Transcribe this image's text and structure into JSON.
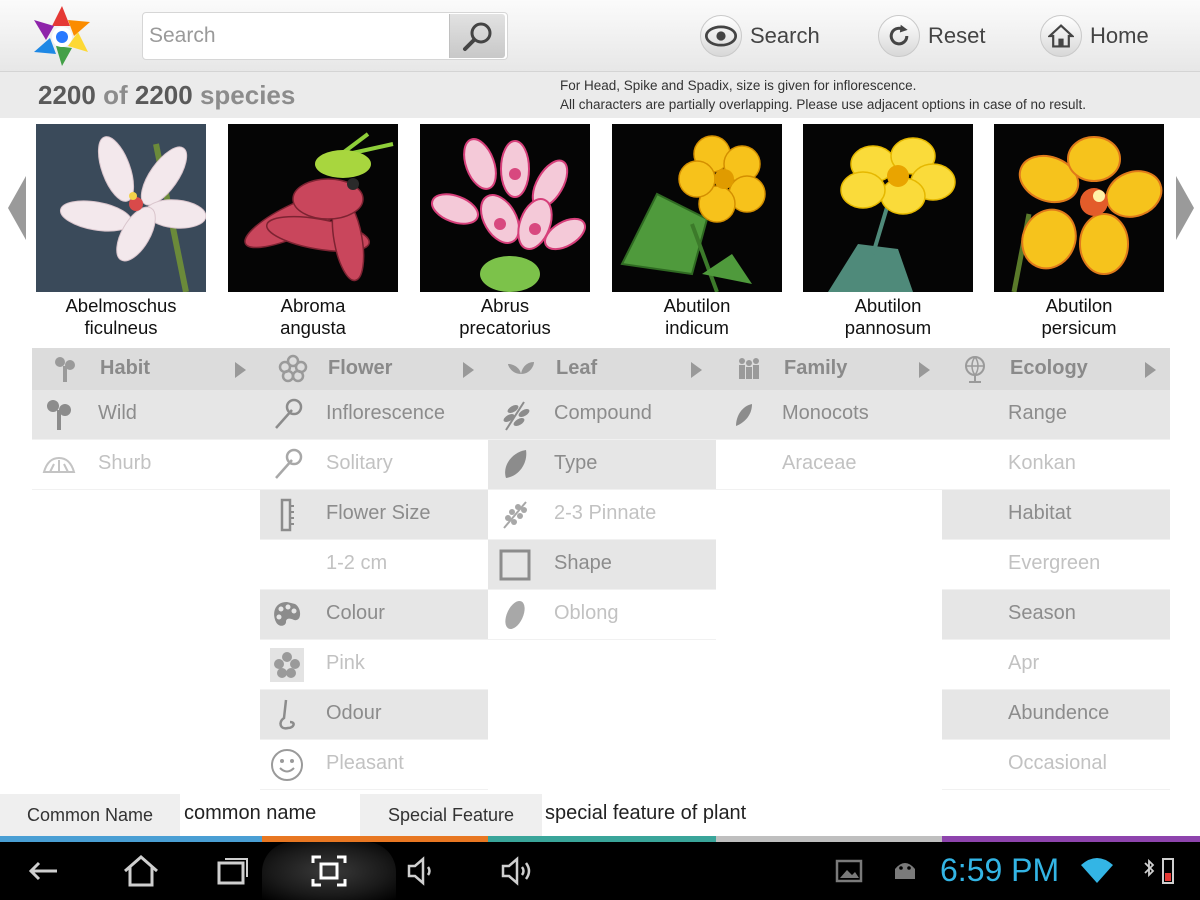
{
  "search": {
    "placeholder": "Search"
  },
  "top_buttons": [
    {
      "label": "Search",
      "icon": "eye-icon"
    },
    {
      "label": "Reset",
      "icon": "reset-icon"
    },
    {
      "label": "Home",
      "icon": "home-icon"
    }
  ],
  "count": {
    "shown": "2200",
    "of": "of",
    "total": "2200",
    "unit": "species"
  },
  "note": {
    "line1": "For Head, Spike and Spadix, size is given for inflorescence.",
    "line2": "All characters are partially overlapping. Please use adjacent options in case of no result."
  },
  "species": [
    {
      "line1": "Abelmoschus",
      "line2": "ficulneus"
    },
    {
      "line1": "Abroma",
      "line2": "angusta"
    },
    {
      "line1": "Abrus",
      "line2": "precatorius"
    },
    {
      "line1": "Abutilon",
      "line2": "indicum"
    },
    {
      "line1": "Abutilon",
      "line2": "pannosum"
    },
    {
      "line1": "Abutilon",
      "line2": "persicum"
    }
  ],
  "filters": {
    "habit": {
      "header": "Habit",
      "rows": [
        "Wild",
        "Shurb"
      ]
    },
    "flower": {
      "header": "Flower",
      "rows": [
        "Inflorescence",
        "Solitary",
        "Flower Size",
        "1-2 cm",
        "Colour",
        "Pink",
        "Odour",
        "Pleasant"
      ]
    },
    "leaf": {
      "header": "Leaf",
      "rows": [
        "Compound",
        "Type",
        "2-3 Pinnate",
        "Shape",
        "Oblong"
      ]
    },
    "family": {
      "header": "Family",
      "rows": [
        "Monocots",
        "Araceae"
      ]
    },
    "ecology": {
      "header": "Ecology",
      "rows": [
        "Range",
        "Konkan",
        "Habitat",
        "Evergreen",
        "Season",
        "Apr",
        "Abundence",
        "Occasional"
      ]
    }
  },
  "info": {
    "common_label": "Common Name",
    "common_value": "common name",
    "feature_label": "Special Feature",
    "feature_value": "special feature of plant"
  },
  "status": {
    "time": "6:59 PM"
  },
  "colors": {
    "accent_blue": "#33b5e5",
    "stripe_colors": [
      "#4a9fd4",
      "#e87722",
      "#3aa59a",
      "#bfbfbf",
      "#8e44ad"
    ]
  }
}
